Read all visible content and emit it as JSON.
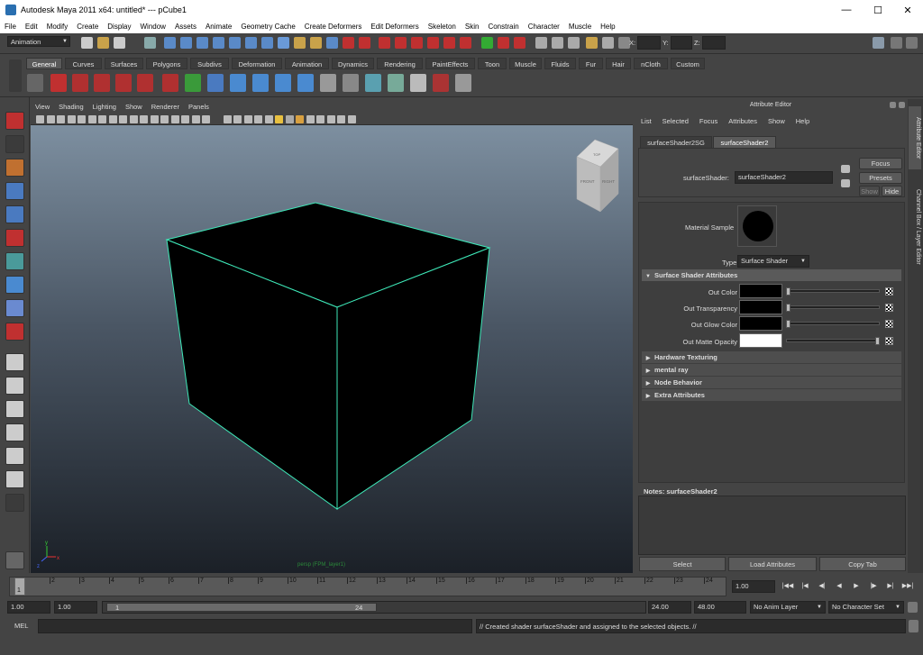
{
  "window": {
    "title": "Autodesk Maya 2011 x64: untitled*   ---   pCube1",
    "minimize": "—",
    "maximize": "☐",
    "close": "✕"
  },
  "menubar": [
    "File",
    "Edit",
    "Modify",
    "Create",
    "Display",
    "Window",
    "Assets",
    "Animate",
    "Geometry Cache",
    "Create Deformers",
    "Edit Deformers",
    "Skeleton",
    "Skin",
    "Constrain",
    "Character",
    "Muscle",
    "Help"
  ],
  "status": {
    "mode": "Animation",
    "x_label": "X:",
    "y_label": "Y:",
    "z_label": "Z:"
  },
  "shelf_tabs": [
    "General",
    "Curves",
    "Surfaces",
    "Polygons",
    "Subdivs",
    "Deformation",
    "Animation",
    "Dynamics",
    "Rendering",
    "PaintEffects",
    "Toon",
    "Muscle",
    "Fluids",
    "Fur",
    "Hair",
    "nCloth",
    "Custom"
  ],
  "viewport": {
    "menu": [
      "View",
      "Shading",
      "Lighting",
      "Show",
      "Renderer",
      "Panels"
    ],
    "camera_label": "persp (FPM_layer1)",
    "viewcube_front": "FRONT",
    "viewcube_right": "RIGHT",
    "viewcube_top": "TOP",
    "axis_x": "x",
    "axis_y": "y",
    "axis_z": "z"
  },
  "attribute_editor": {
    "header": "Attribute Editor",
    "menu": [
      "List",
      "Selected",
      "Focus",
      "Attributes",
      "Show",
      "Help"
    ],
    "tabs": [
      "surfaceShader2SG",
      "surfaceShader2"
    ],
    "node_label": "surfaceShader:",
    "node_value": "surfaceShader2",
    "focus": "Focus",
    "presets": "Presets",
    "show": "Show",
    "hide": "Hide",
    "material_sample": "Material Sample",
    "type_label": "Type",
    "type_value": "Surface Shader",
    "section_main": "Surface Shader Attributes",
    "attrs": [
      {
        "label": "Out Color",
        "swatch": "#000000",
        "level": 0
      },
      {
        "label": "Out Transparency",
        "swatch": "#000000",
        "level": 0
      },
      {
        "label": "Out Glow Color",
        "swatch": "#000000",
        "level": 0
      },
      {
        "label": "Out Matte Opacity",
        "swatch": "#ffffff",
        "level": 1
      }
    ],
    "sections": [
      "Hardware Texturing",
      "mental ray",
      "Node Behavior",
      "Extra Attributes"
    ],
    "notes_label": "Notes:  surfaceShader2",
    "bottom_buttons": [
      "Select",
      "Load Attributes",
      "Copy Tab"
    ]
  },
  "side_tabs": [
    "Attribute Editor",
    "Channel Box / Layer Editor"
  ],
  "timeline": {
    "ticks": [
      "1",
      "2",
      "3",
      "4",
      "5",
      "6",
      "7",
      "8",
      "9",
      "10",
      "11",
      "12",
      "13",
      "14",
      "15",
      "16",
      "17",
      "18",
      "19",
      "20",
      "21",
      "22",
      "23",
      "24"
    ],
    "current_frame": "1",
    "current_field": "1.00"
  },
  "range": {
    "start": "1.00",
    "start2": "1.00",
    "slider_start": "1",
    "slider_end": "24",
    "end": "24.00",
    "end2": "48.00",
    "anim_layer": "No Anim Layer",
    "char_set": "No Character Set"
  },
  "cmdline": {
    "label": "MEL",
    "feedback": "// Created shader surfaceShader and assigned to the selected objects. //"
  }
}
